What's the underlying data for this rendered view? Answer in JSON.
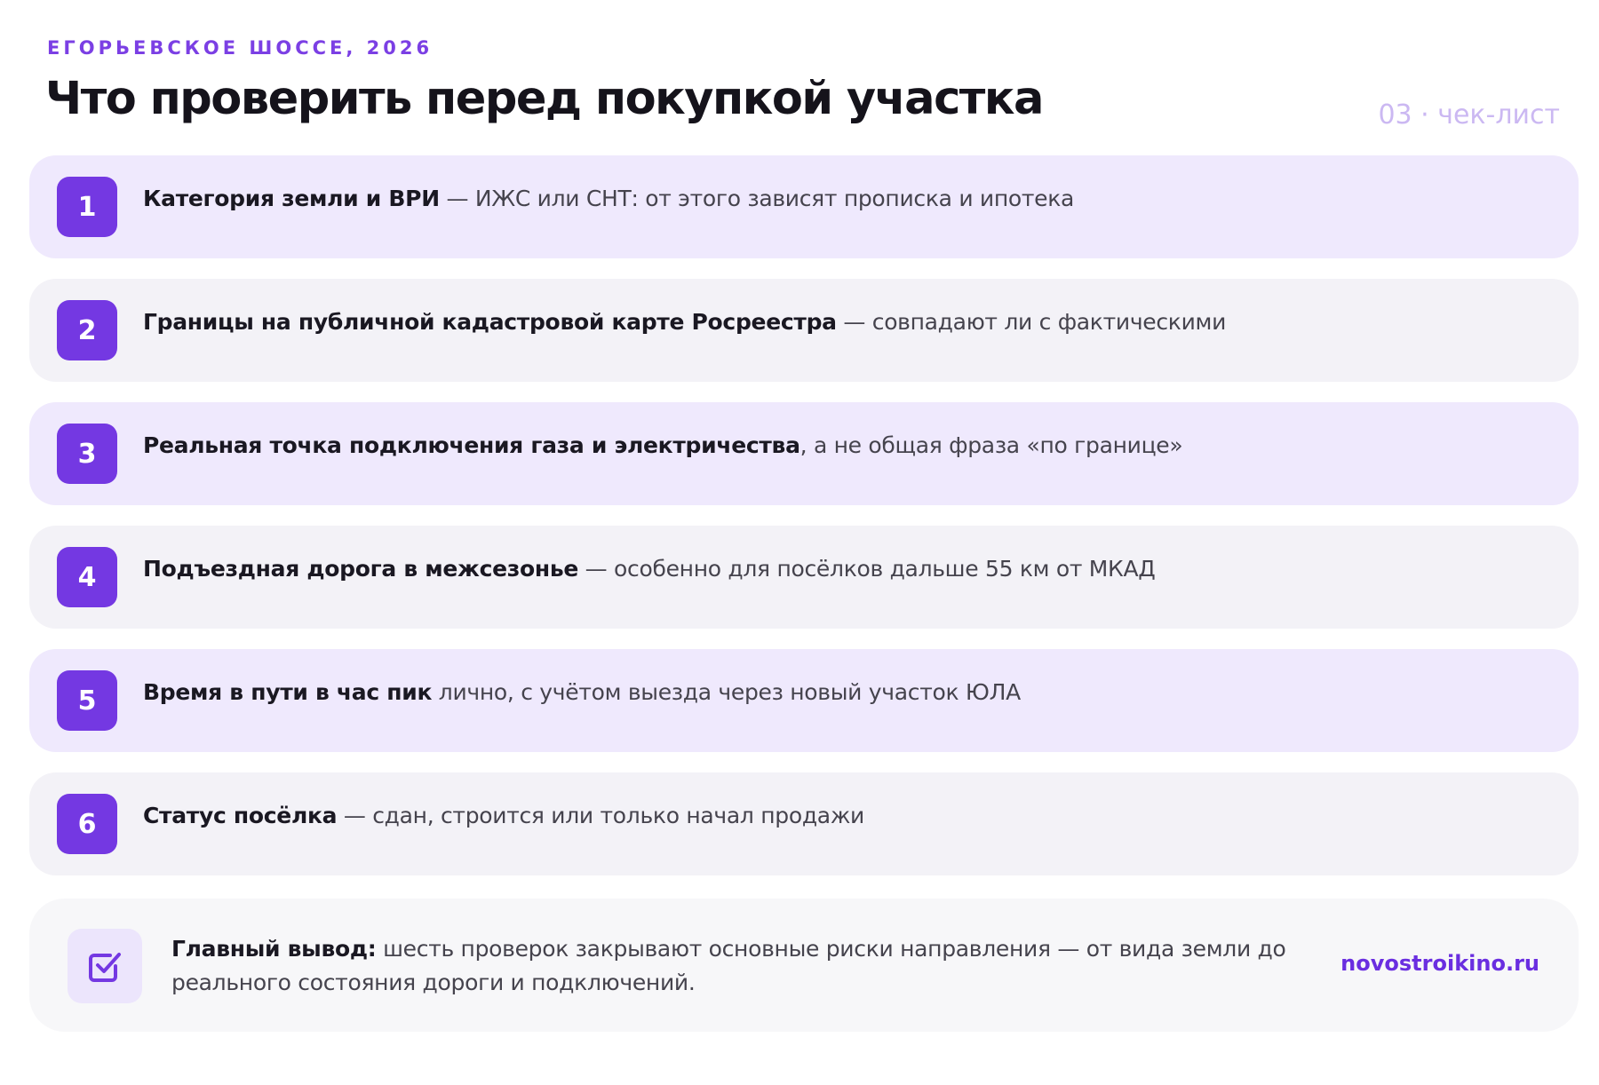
{
  "header": {
    "kicker": "ЕГОРЬЕВСКОЕ ШОССЕ, 2026",
    "title": "Что проверить перед покупкой участка",
    "page_label": "03 · чек-лист"
  },
  "checklist": [
    {
      "number": "1",
      "bold": "Категория земли и ВРИ",
      "rest": " — ИЖС или СНТ: от этого зависят прописка и ипотека"
    },
    {
      "number": "2",
      "bold": "Границы на публичной кадастровой карте Росреестра",
      "rest": " — совпадают ли с фактическими"
    },
    {
      "number": "3",
      "bold": "Реальная точка подключения газа и электричества",
      "rest": ", а не общая фраза «по границе»"
    },
    {
      "number": "4",
      "bold": "Подъездная дорога в межсезонье",
      "rest": " — особенно для посёлков дальше 55 км от МКАД"
    },
    {
      "number": "5",
      "bold": "Время в пути в час пик",
      "rest": " лично, с учётом выезда через новый участок ЮЛА"
    },
    {
      "number": "6",
      "bold": "Статус посёлка",
      "rest": " — сдан, строится или только начал продажи"
    }
  ],
  "summary": {
    "icon": "checkbox-check-icon",
    "bold": "Главный вывод:",
    "rest": " шесть проверок закрывают основные риски направления — от вида земли до реального состояния дороги и подключений.",
    "site": "novostroikino.ru"
  },
  "colors": {
    "accent": "#7438e2",
    "odd_row": "#efe9fd",
    "even_row": "#f3f2f7"
  }
}
